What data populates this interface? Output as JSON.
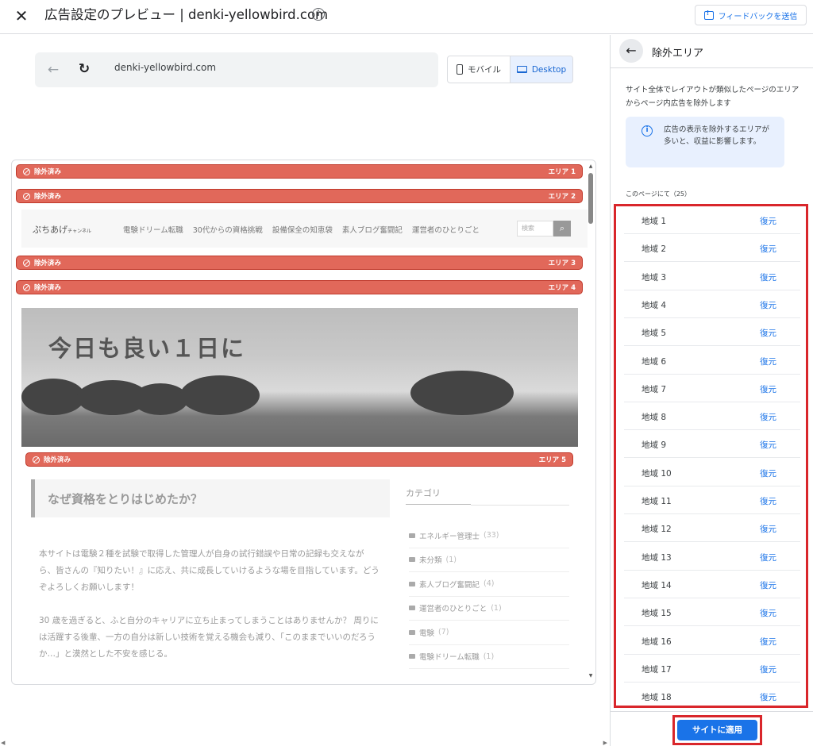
{
  "header": {
    "title": "広告設定のプレビュー | denki-yellowbird.com",
    "feedback_label": "フィードバックを送信"
  },
  "browser": {
    "url": "denki-yellowbird.com",
    "mobile_label": "モバイル",
    "desktop_label": "Desktop"
  },
  "site": {
    "excluded_label": "除外済み",
    "area_labels": [
      "エリア 1",
      "エリア 2",
      "エリア 3",
      "エリア 4",
      "エリア 5"
    ],
    "logo": "ぷちあげ",
    "logo_sub": "チャンネル",
    "nav": [
      "電験ドリーム転職",
      "30代からの資格挑戦",
      "設備保全の知恵袋",
      "素人ブログ奮闘記",
      "運営者のひとりごと"
    ],
    "search_placeholder": "検索",
    "hero_text": "今日も良い１日に",
    "post_title": "なぜ資格をとりはじめたか？",
    "post_p1": "本サイトは電験２種を試験で取得した管理人が自身の試行錯誤や日常の記録も交えながら、皆さんの『知りたい！』に応え、共に成長していけるような場を目指しています。どうぞよろしくお願いします！",
    "post_p2": "30 歳を過ぎると、ふと自分のキャリアに立ち止まってしまうことはありませんか？ 周りには活躍する後輩、一方の自分は新しい技術を覚える機会も減り、「このままでいいのだろうか…」と漠然とした不安を感じる。",
    "category_heading": "カテゴリ",
    "categories": [
      {
        "name": "エネルギー管理士",
        "count": "(33)"
      },
      {
        "name": "未分類",
        "count": "(1)"
      },
      {
        "name": "素人ブログ奮闘記",
        "count": "(4)"
      },
      {
        "name": "運営者のひとりごと",
        "count": "(1)"
      },
      {
        "name": "電験",
        "count": "(7)"
      },
      {
        "name": "電験ドリーム転職",
        "count": "(1)"
      }
    ]
  },
  "panel": {
    "title": "除外エリア",
    "description": "サイト全体でレイアウトが類似したページのエリアからページ内広告を除外します",
    "info": "広告の表示を除外するエリアが多いと、収益に影響します。",
    "page_count_label": "このページにて（25）",
    "restore_label": "復元",
    "regions": [
      "地域 1",
      "地域 2",
      "地域 3",
      "地域 4",
      "地域 5",
      "地域 6",
      "地域 7",
      "地域 8",
      "地域 9",
      "地域 10",
      "地域 11",
      "地域 12",
      "地域 13",
      "地域 14",
      "地域 15",
      "地域 16",
      "地域 17",
      "地域 18"
    ],
    "apply_label": "サイトに適用"
  }
}
